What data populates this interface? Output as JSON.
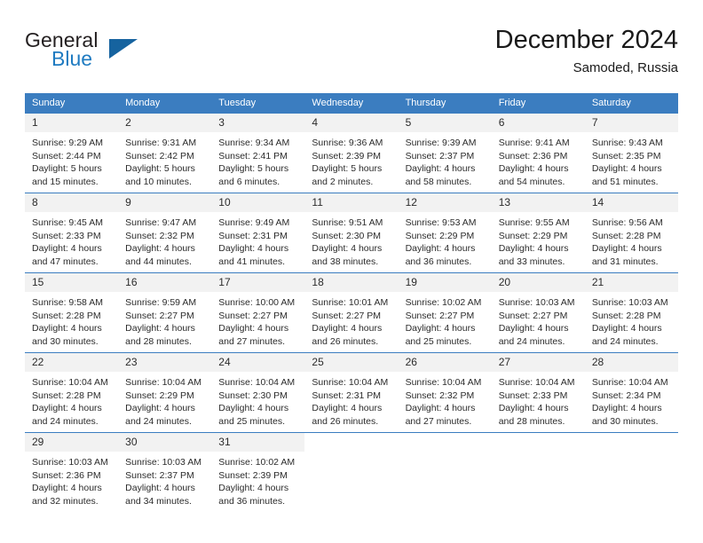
{
  "brand": {
    "name_top": "General",
    "name_bottom": "Blue",
    "triangle_color": "#16639f",
    "blue_color": "#1f7bc1"
  },
  "header": {
    "title": "December 2024",
    "subtitle": "Samoded, Russia"
  },
  "theme": {
    "header_bg": "#3b7dc0",
    "header_text": "#ffffff",
    "daynum_bg": "#f2f2f2",
    "cell_bg": "#ffffff",
    "grid_line": "#3b7dc0",
    "body_text": "#2b2b2b"
  },
  "weekdays": [
    "Sunday",
    "Monday",
    "Tuesday",
    "Wednesday",
    "Thursday",
    "Friday",
    "Saturday"
  ],
  "weeks": [
    [
      {
        "day": "1",
        "sunrise": "Sunrise: 9:29 AM",
        "sunset": "Sunset: 2:44 PM",
        "daylight1": "Daylight: 5 hours",
        "daylight2": "and 15 minutes."
      },
      {
        "day": "2",
        "sunrise": "Sunrise: 9:31 AM",
        "sunset": "Sunset: 2:42 PM",
        "daylight1": "Daylight: 5 hours",
        "daylight2": "and 10 minutes."
      },
      {
        "day": "3",
        "sunrise": "Sunrise: 9:34 AM",
        "sunset": "Sunset: 2:41 PM",
        "daylight1": "Daylight: 5 hours",
        "daylight2": "and 6 minutes."
      },
      {
        "day": "4",
        "sunrise": "Sunrise: 9:36 AM",
        "sunset": "Sunset: 2:39 PM",
        "daylight1": "Daylight: 5 hours",
        "daylight2": "and 2 minutes."
      },
      {
        "day": "5",
        "sunrise": "Sunrise: 9:39 AM",
        "sunset": "Sunset: 2:37 PM",
        "daylight1": "Daylight: 4 hours",
        "daylight2": "and 58 minutes."
      },
      {
        "day": "6",
        "sunrise": "Sunrise: 9:41 AM",
        "sunset": "Sunset: 2:36 PM",
        "daylight1": "Daylight: 4 hours",
        "daylight2": "and 54 minutes."
      },
      {
        "day": "7",
        "sunrise": "Sunrise: 9:43 AM",
        "sunset": "Sunset: 2:35 PM",
        "daylight1": "Daylight: 4 hours",
        "daylight2": "and 51 minutes."
      }
    ],
    [
      {
        "day": "8",
        "sunrise": "Sunrise: 9:45 AM",
        "sunset": "Sunset: 2:33 PM",
        "daylight1": "Daylight: 4 hours",
        "daylight2": "and 47 minutes."
      },
      {
        "day": "9",
        "sunrise": "Sunrise: 9:47 AM",
        "sunset": "Sunset: 2:32 PM",
        "daylight1": "Daylight: 4 hours",
        "daylight2": "and 44 minutes."
      },
      {
        "day": "10",
        "sunrise": "Sunrise: 9:49 AM",
        "sunset": "Sunset: 2:31 PM",
        "daylight1": "Daylight: 4 hours",
        "daylight2": "and 41 minutes."
      },
      {
        "day": "11",
        "sunrise": "Sunrise: 9:51 AM",
        "sunset": "Sunset: 2:30 PM",
        "daylight1": "Daylight: 4 hours",
        "daylight2": "and 38 minutes."
      },
      {
        "day": "12",
        "sunrise": "Sunrise: 9:53 AM",
        "sunset": "Sunset: 2:29 PM",
        "daylight1": "Daylight: 4 hours",
        "daylight2": "and 36 minutes."
      },
      {
        "day": "13",
        "sunrise": "Sunrise: 9:55 AM",
        "sunset": "Sunset: 2:29 PM",
        "daylight1": "Daylight: 4 hours",
        "daylight2": "and 33 minutes."
      },
      {
        "day": "14",
        "sunrise": "Sunrise: 9:56 AM",
        "sunset": "Sunset: 2:28 PM",
        "daylight1": "Daylight: 4 hours",
        "daylight2": "and 31 minutes."
      }
    ],
    [
      {
        "day": "15",
        "sunrise": "Sunrise: 9:58 AM",
        "sunset": "Sunset: 2:28 PM",
        "daylight1": "Daylight: 4 hours",
        "daylight2": "and 30 minutes."
      },
      {
        "day": "16",
        "sunrise": "Sunrise: 9:59 AM",
        "sunset": "Sunset: 2:27 PM",
        "daylight1": "Daylight: 4 hours",
        "daylight2": "and 28 minutes."
      },
      {
        "day": "17",
        "sunrise": "Sunrise: 10:00 AM",
        "sunset": "Sunset: 2:27 PM",
        "daylight1": "Daylight: 4 hours",
        "daylight2": "and 27 minutes."
      },
      {
        "day": "18",
        "sunrise": "Sunrise: 10:01 AM",
        "sunset": "Sunset: 2:27 PM",
        "daylight1": "Daylight: 4 hours",
        "daylight2": "and 26 minutes."
      },
      {
        "day": "19",
        "sunrise": "Sunrise: 10:02 AM",
        "sunset": "Sunset: 2:27 PM",
        "daylight1": "Daylight: 4 hours",
        "daylight2": "and 25 minutes."
      },
      {
        "day": "20",
        "sunrise": "Sunrise: 10:03 AM",
        "sunset": "Sunset: 2:27 PM",
        "daylight1": "Daylight: 4 hours",
        "daylight2": "and 24 minutes."
      },
      {
        "day": "21",
        "sunrise": "Sunrise: 10:03 AM",
        "sunset": "Sunset: 2:28 PM",
        "daylight1": "Daylight: 4 hours",
        "daylight2": "and 24 minutes."
      }
    ],
    [
      {
        "day": "22",
        "sunrise": "Sunrise: 10:04 AM",
        "sunset": "Sunset: 2:28 PM",
        "daylight1": "Daylight: 4 hours",
        "daylight2": "and 24 minutes."
      },
      {
        "day": "23",
        "sunrise": "Sunrise: 10:04 AM",
        "sunset": "Sunset: 2:29 PM",
        "daylight1": "Daylight: 4 hours",
        "daylight2": "and 24 minutes."
      },
      {
        "day": "24",
        "sunrise": "Sunrise: 10:04 AM",
        "sunset": "Sunset: 2:30 PM",
        "daylight1": "Daylight: 4 hours",
        "daylight2": "and 25 minutes."
      },
      {
        "day": "25",
        "sunrise": "Sunrise: 10:04 AM",
        "sunset": "Sunset: 2:31 PM",
        "daylight1": "Daylight: 4 hours",
        "daylight2": "and 26 minutes."
      },
      {
        "day": "26",
        "sunrise": "Sunrise: 10:04 AM",
        "sunset": "Sunset: 2:32 PM",
        "daylight1": "Daylight: 4 hours",
        "daylight2": "and 27 minutes."
      },
      {
        "day": "27",
        "sunrise": "Sunrise: 10:04 AM",
        "sunset": "Sunset: 2:33 PM",
        "daylight1": "Daylight: 4 hours",
        "daylight2": "and 28 minutes."
      },
      {
        "day": "28",
        "sunrise": "Sunrise: 10:04 AM",
        "sunset": "Sunset: 2:34 PM",
        "daylight1": "Daylight: 4 hours",
        "daylight2": "and 30 minutes."
      }
    ],
    [
      {
        "day": "29",
        "sunrise": "Sunrise: 10:03 AM",
        "sunset": "Sunset: 2:36 PM",
        "daylight1": "Daylight: 4 hours",
        "daylight2": "and 32 minutes."
      },
      {
        "day": "30",
        "sunrise": "Sunrise: 10:03 AM",
        "sunset": "Sunset: 2:37 PM",
        "daylight1": "Daylight: 4 hours",
        "daylight2": "and 34 minutes."
      },
      {
        "day": "31",
        "sunrise": "Sunrise: 10:02 AM",
        "sunset": "Sunset: 2:39 PM",
        "daylight1": "Daylight: 4 hours",
        "daylight2": "and 36 minutes."
      },
      {
        "day": "",
        "sunrise": "",
        "sunset": "",
        "daylight1": "",
        "daylight2": ""
      },
      {
        "day": "",
        "sunrise": "",
        "sunset": "",
        "daylight1": "",
        "daylight2": ""
      },
      {
        "day": "",
        "sunrise": "",
        "sunset": "",
        "daylight1": "",
        "daylight2": ""
      },
      {
        "day": "",
        "sunrise": "",
        "sunset": "",
        "daylight1": "",
        "daylight2": ""
      }
    ]
  ]
}
